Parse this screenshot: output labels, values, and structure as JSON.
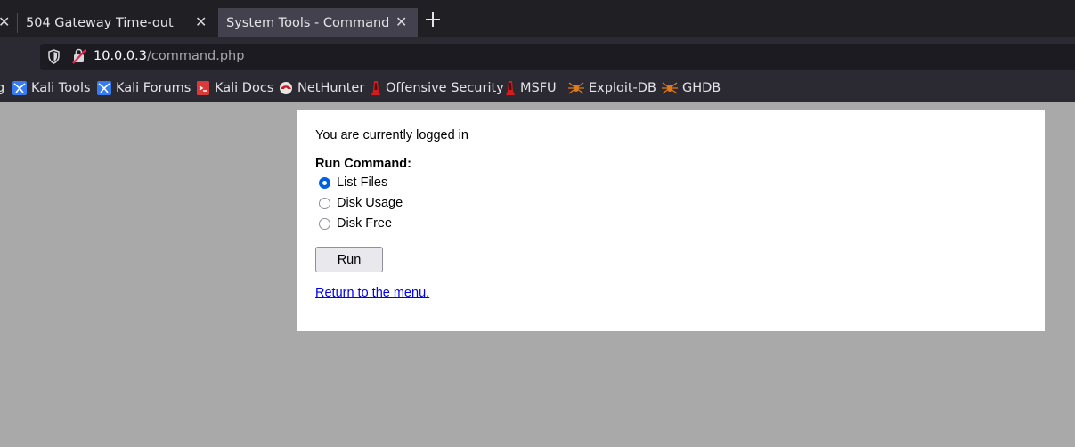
{
  "browser": {
    "tabs": [
      {
        "title": "504 Gateway Time-out",
        "active": false
      },
      {
        "title": "System Tools - Command",
        "active": true
      }
    ],
    "url": {
      "host": "10.0.0.3",
      "path": "/command.php"
    },
    "bookmarks": [
      {
        "label": "Kali Tools",
        "icon": "kali-icon"
      },
      {
        "label": "Kali Forums",
        "icon": "kali-icon"
      },
      {
        "label": "Kali Docs",
        "icon": "docs-icon"
      },
      {
        "label": "NetHunter",
        "icon": "nethunter-icon"
      },
      {
        "label": "Offensive Security",
        "icon": "offsec-icon"
      },
      {
        "label": "MSFU",
        "icon": "offsec-icon"
      },
      {
        "label": "Exploit-DB",
        "icon": "exploitdb-icon"
      },
      {
        "label": "GHDB",
        "icon": "exploitdb-icon"
      }
    ]
  },
  "page": {
    "status_text": "You are currently logged in",
    "run_heading": "Run Command:",
    "options": [
      {
        "label": "List Files",
        "checked": true
      },
      {
        "label": "Disk Usage",
        "checked": false
      },
      {
        "label": "Disk Free",
        "checked": false
      }
    ],
    "run_button": "Run",
    "menu_link": "Return to the menu."
  },
  "colors": {
    "page_background": "#a9a9a9",
    "link": "#0000ee",
    "radio_checked": "#0060df"
  }
}
